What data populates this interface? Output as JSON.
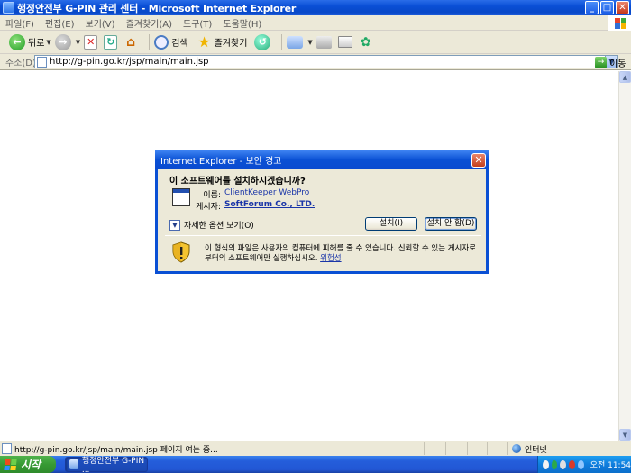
{
  "window": {
    "title": "행정안전부 G-PIN 관리 센터 - Microsoft Internet Explorer",
    "min_label": "_",
    "max_label": "□",
    "close_label": "✕"
  },
  "menu": {
    "items": [
      {
        "label": "파일(F)"
      },
      {
        "label": "편집(E)"
      },
      {
        "label": "보기(V)"
      },
      {
        "label": "즐겨찾기(A)"
      },
      {
        "label": "도구(T)"
      },
      {
        "label": "도움말(H)"
      }
    ]
  },
  "toolbar": {
    "back_label": "뒤로",
    "search_label": "검색",
    "favorites_label": "즐겨찾기"
  },
  "address": {
    "label": "주소(D)",
    "url": "http://g-pin.go.kr/jsp/main/main.jsp",
    "go_label": "이동"
  },
  "dialog": {
    "title": "Internet Explorer - 보안 경고",
    "question": "이 소프트웨어를 설치하시겠습니까?",
    "name_label": "이름:",
    "name_value": "ClientKeeper WebPro",
    "publisher_label": "게시자:",
    "publisher_value": "SoftForum Co., LTD.",
    "more_options_label": "자세한 옵션 보기(O)",
    "install_button": "설치(I)",
    "dont_install_button": "설치 안 함(D)",
    "warning_text": "이 형식의 파일은 사용자의 컴퓨터에 피해를 줄 수 있습니다. 신뢰할 수 있는 게시자로부터의 소프트웨어만 실행하십시오.",
    "risk_link": "위험성"
  },
  "status": {
    "text": "http://g-pin.go.kr/jsp/main/main.jsp 페이지 여는 중...",
    "zone": "인터넷"
  },
  "taskbar": {
    "start_label": "시작",
    "task_item": "행정안전부 G-PIN ...",
    "clock": "오전 11:54"
  },
  "colors": {
    "title_bar": "#0a4fd6",
    "chrome": "#ece9d8",
    "link": "#1a35a8",
    "taskbar": "#245edb",
    "start": "#379a34"
  }
}
